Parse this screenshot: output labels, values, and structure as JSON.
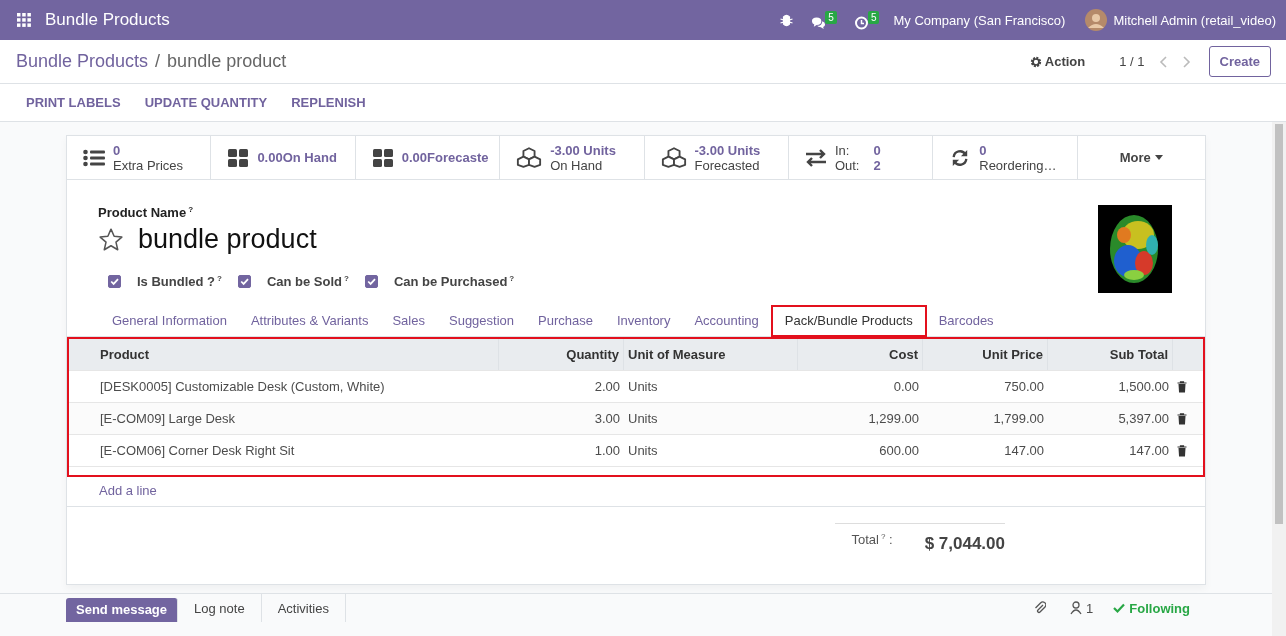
{
  "navbar": {
    "app_title": "Bundle Products",
    "messages_badge": "5",
    "activities_badge": "5",
    "company": "My Company (San Francisco)",
    "user": "Mitchell Admin (retail_video)"
  },
  "breadcrumb": {
    "parent": "Bundle Products",
    "separator": "/",
    "current": "bundle product",
    "action": "Action",
    "pager": "1 / 1",
    "create": "Create"
  },
  "header_buttons": [
    "PRINT LABELS",
    "UPDATE QUANTITY",
    "REPLENISH"
  ],
  "stat_buttons": [
    {
      "kind": "two_line",
      "value": "0",
      "label": "Extra Prices"
    },
    {
      "kind": "one_line",
      "value": "0.00On Hand"
    },
    {
      "kind": "one_line",
      "value": "0.00Forecaste"
    },
    {
      "kind": "two_line",
      "value": "-3.00 Units",
      "label": "On Hand"
    },
    {
      "kind": "two_line",
      "value": "-3.00 Units",
      "label": "Forecasted"
    },
    {
      "kind": "in_out",
      "in_label": "In:",
      "in_value": "0",
      "out_label": "Out:",
      "out_value": "2"
    },
    {
      "kind": "two_line",
      "value": "0",
      "label": "Reordering…"
    },
    {
      "kind": "more",
      "label": "More"
    }
  ],
  "product": {
    "label": "Product Name",
    "help": "?",
    "name": "bundle product",
    "starred": false
  },
  "checkboxes": [
    {
      "label": "Is Bundled ?",
      "help": "?",
      "checked": true
    },
    {
      "label": "Can be Sold",
      "help": "?",
      "checked": true
    },
    {
      "label": "Can be Purchased",
      "help": "?",
      "checked": true
    }
  ],
  "tabs": [
    {
      "label": "General Information",
      "selected": false,
      "highlighted": false
    },
    {
      "label": "Attributes & Variants",
      "selected": false,
      "highlighted": false
    },
    {
      "label": "Sales",
      "selected": false,
      "highlighted": false
    },
    {
      "label": "Suggestion",
      "selected": false,
      "highlighted": false
    },
    {
      "label": "Purchase",
      "selected": false,
      "highlighted": false
    },
    {
      "label": "Inventory",
      "selected": false,
      "highlighted": false
    },
    {
      "label": "Accounting",
      "selected": false,
      "highlighted": false
    },
    {
      "label": "Pack/Bundle Products",
      "selected": true,
      "highlighted": true
    },
    {
      "label": "Barcodes",
      "selected": false,
      "highlighted": false
    }
  ],
  "table": {
    "highlighted": true,
    "columns": [
      {
        "label": "Product",
        "kind": "text"
      },
      {
        "label": "Quantity",
        "kind": "number"
      },
      {
        "label": "Unit of Measure",
        "kind": "text"
      },
      {
        "label": "Cost",
        "kind": "number"
      },
      {
        "label": "Unit Price",
        "kind": "number"
      },
      {
        "label": "Sub Total",
        "kind": "number"
      }
    ],
    "rows": [
      [
        "[DESK0005] Customizable Desk (Custom, White)",
        "2.00",
        "Units",
        "0.00",
        "750.00",
        "1,500.00"
      ],
      [
        "[E-COM09] Large Desk",
        "3.00",
        "Units",
        "1,299.00",
        "1,799.00",
        "5,397.00"
      ],
      [
        "[E-COM06] Corner Desk Right Sit",
        "1.00",
        "Units",
        "600.00",
        "147.00",
        "147.00"
      ]
    ],
    "add_line": "Add a line"
  },
  "total": {
    "label": "Total",
    "help": "?",
    "colon": ":",
    "value": "$ 7,044.00"
  },
  "chatter": {
    "buttons": [
      "Send message",
      "Log note",
      "Activities"
    ],
    "followers": "1",
    "following": "Following"
  }
}
